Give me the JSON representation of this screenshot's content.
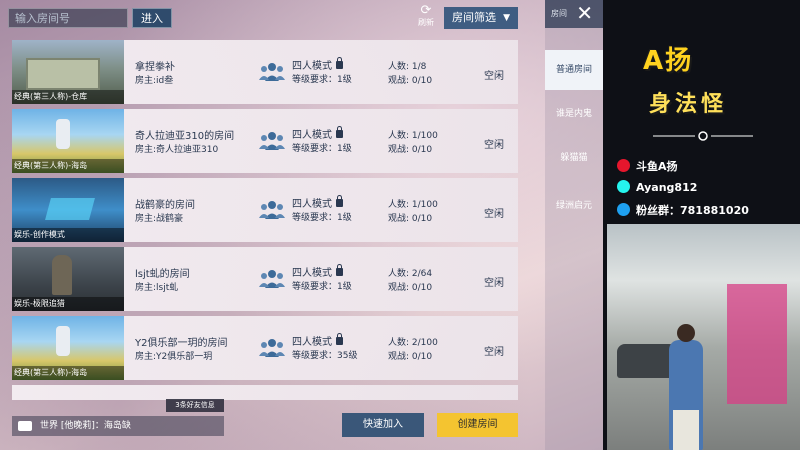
{
  "topbar": {
    "room_input_placeholder": "输入房间号",
    "enter_label": "进入",
    "refresh_label": "刷新",
    "filter_label": "房间筛选"
  },
  "tabs": {
    "header": "房间",
    "items": [
      {
        "label": "普通房间",
        "active": true
      },
      {
        "label": "谁是内鬼",
        "active": false
      },
      {
        "label": "躲猫猫",
        "active": false
      },
      {
        "label": "绿洲启元",
        "active": false
      }
    ]
  },
  "rooms": [
    {
      "thumb_caption": "经典(第三人称)-仓库",
      "name": "拿捏拳补",
      "owner": "房主:id叁",
      "mode": "四人模式",
      "level": "等级要求：1级",
      "count": "人数: 1/8",
      "watch": "观战: 0/10",
      "status": "空闲",
      "thumb": "city"
    },
    {
      "thumb_caption": "经典(第三人称)-海岛",
      "name": "奇人拉迪亚310的房间",
      "owner": "房主:奇人拉迪亚310",
      "mode": "四人模式",
      "level": "等级要求：1级",
      "count": "人数: 1/100",
      "watch": "观战: 0/10",
      "status": "空闲",
      "thumb": "island"
    },
    {
      "thumb_caption": "娱乐-创作模式",
      "name": "战鹤豪的房间",
      "owner": "房主:战鹤豪",
      "mode": "四人模式",
      "level": "等级要求：1级",
      "count": "人数: 1/100",
      "watch": "观战: 0/10",
      "status": "空闲",
      "thumb": "creative"
    },
    {
      "thumb_caption": "娱乐-极限追猎",
      "name": "lsjt虬的房间",
      "owner": "房主:lsjt虬",
      "mode": "四人模式",
      "level": "等级要求：1级",
      "count": "人数: 2/64",
      "watch": "观战: 0/10",
      "status": "空闲",
      "thumb": "soldier"
    },
    {
      "thumb_caption": "经典(第三人称)-海岛",
      "name": "Y2俱乐部一玥的房间",
      "owner": "房主:Y2俱乐部一玥",
      "mode": "四人模式",
      "level": "等级要求：35级",
      "count": "人数: 2/100",
      "watch": "观战: 0/10",
      "status": "空闲",
      "thumb": "island"
    }
  ],
  "bottom": {
    "friend_badge": "3条好友信息",
    "chat_text": "世界 [他晚莉]：海岛缺",
    "quick_join_label": "快速加入",
    "create_room_label": "创建房间"
  },
  "stream": {
    "brand_line1": "A扬",
    "brand_line2": "身法怪",
    "weibo": "斗鱼A扬",
    "douyin": "Ayang812",
    "qq": "粉丝群：781881020",
    "weibo_color": "#e6162d",
    "douyin_color": "#25f4ee",
    "qq_color": "#1ea0f0"
  }
}
